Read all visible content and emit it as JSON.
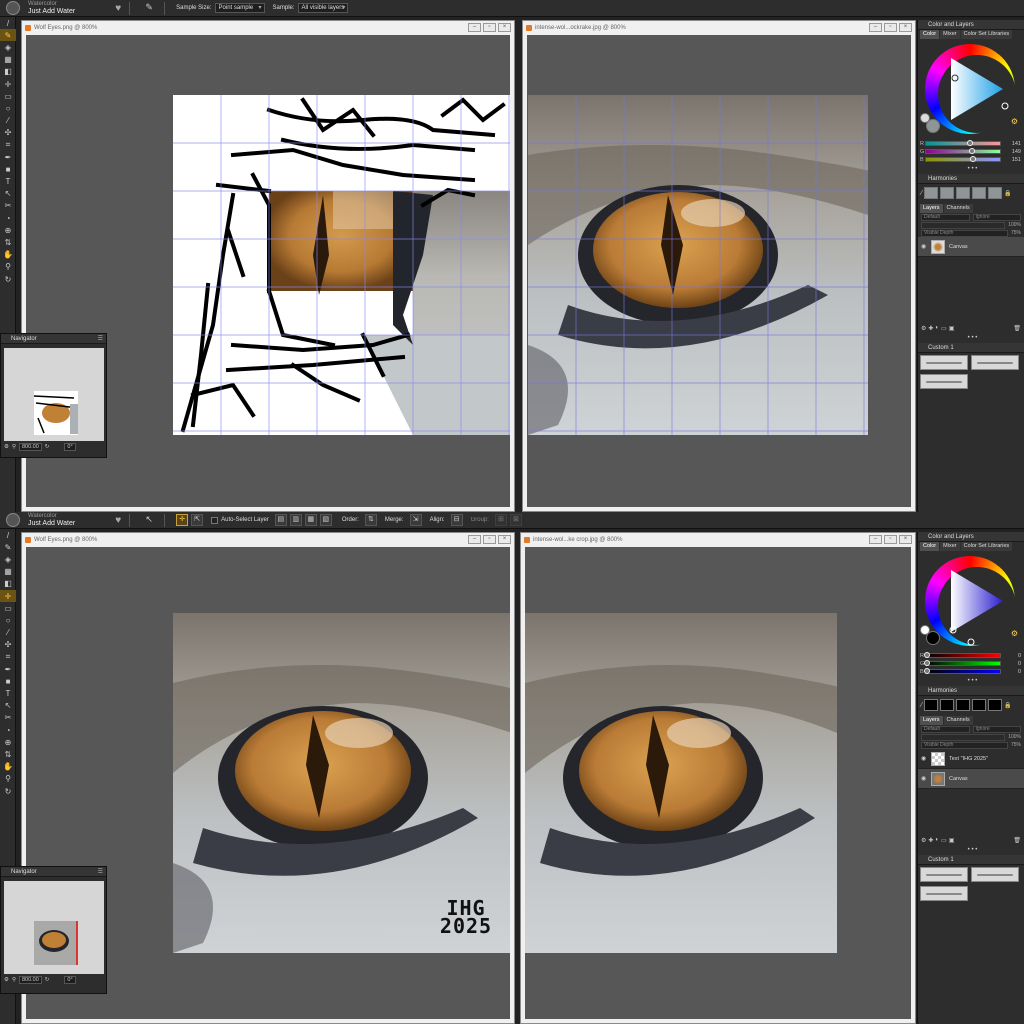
{
  "top": {
    "brush": {
      "category": "Watercolor",
      "name": "Just Add Water"
    },
    "sample_size_label": "Sample Size:",
    "sample_size_value": "Point sample",
    "sample_label": "Sample:",
    "sample_value": "All visible layers",
    "doc_left_title": "Wolf Eyes.png @ 800%",
    "doc_right_title": "intense-wol...ockrake.jpg @ 800%",
    "color_panel": {
      "title": "Color and Layers",
      "tabs": [
        "Color",
        "Mixer",
        "Color Set Libraries"
      ],
      "r": {
        "label": "R",
        "value": "141"
      },
      "g": {
        "label": "G",
        "value": "149"
      },
      "b": {
        "label": "B",
        "value": "151"
      },
      "current_color": "#8d9597"
    },
    "harmonies_title": "Harmonies",
    "layers": {
      "tabs": [
        "Layers",
        "Channels"
      ],
      "composite": "Default",
      "ignore": "Ignore",
      "opacity": "100%",
      "depth_label": "Visible Depth",
      "depth": "75%",
      "items": [
        {
          "name": "Canvas"
        }
      ]
    },
    "custom_title": "Custom 1",
    "navigator": {
      "title": "Navigator",
      "zoom": "800.00",
      "angle": "0°"
    }
  },
  "bottom": {
    "brush": {
      "category": "Watercolor",
      "name": "Just Add Water"
    },
    "auto_select": "Auto-Select Layer",
    "order_label": "Order:",
    "merge_label": "Merge:",
    "align_label": "Align:",
    "group_label": "Group:",
    "doc_left_title": "Wolf Eyes.png @ 800%",
    "doc_right_title": "intense-wol...ke crop.jpg @ 800%",
    "color_panel": {
      "title": "Color and Layers",
      "tabs": [
        "Color",
        "Mixer",
        "Color Set Libraries"
      ],
      "r": {
        "label": "R",
        "value": "0"
      },
      "g": {
        "label": "G",
        "value": "0"
      },
      "b": {
        "label": "B",
        "value": "0"
      },
      "current_color": "#000000"
    },
    "harmonies_title": "Harmonies",
    "layers": {
      "tabs": [
        "Layers",
        "Channels"
      ],
      "composite": "Default",
      "ignore": "Ignore",
      "opacity": "100%",
      "depth_label": "Visible Depth",
      "depth": "75%",
      "items": [
        {
          "name": "Text \"IHG 2025\""
        },
        {
          "name": "Canvas"
        }
      ]
    },
    "custom_title": "Custom 1",
    "navigator": {
      "title": "Navigator",
      "zoom": "800.00",
      "angle": "0°"
    },
    "watermark": "IHG 2025"
  },
  "colors": {
    "accent": "#f4c542",
    "eye_orange": "#c98a3a",
    "fur_gray": "#b8bcbe"
  }
}
